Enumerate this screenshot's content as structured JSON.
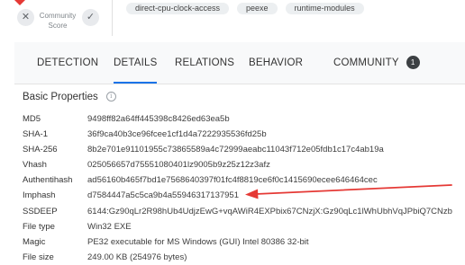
{
  "score": {
    "label": "Community Score",
    "dislike_icon": "close-icon",
    "like_icon": "check-icon"
  },
  "tags": [
    "direct-cpu-clock-access",
    "peexe",
    "runtime-modules"
  ],
  "tabs": [
    {
      "label": "DETECTION",
      "active": false
    },
    {
      "label": "DETAILS",
      "active": true
    },
    {
      "label": "RELATIONS",
      "active": false
    },
    {
      "label": "BEHAVIOR",
      "active": false
    },
    {
      "label": "COMMUNITY",
      "active": false,
      "count": "1"
    }
  ],
  "section": {
    "title": "Basic Properties"
  },
  "properties": [
    {
      "key": "MD5",
      "value": "9498ff82a64ff445398c8426ed63ea5b"
    },
    {
      "key": "SHA-1",
      "value": "36f9ca40b3ce96fcee1cf1d4a7222935536fd25b"
    },
    {
      "key": "SHA-256",
      "value": "8b2e701e91101955c73865589a4c72999aeabc11043f712e05fdb1c17c4ab19a"
    },
    {
      "key": "Vhash",
      "value": "025056657d75551080401lz9005b9z25z12z3afz"
    },
    {
      "key": "Authentihash",
      "value": "ad56160b465f7bd1e7568640397f01fc4f8819ce6f0c1415690ecee646464cec"
    },
    {
      "key": "Imphash",
      "value": "d7584447a5c5ca9b4a55946317137951"
    },
    {
      "key": "SSDEEP",
      "value": "6144:Gz90qLr2R98hUb4UdjzEwG+vqAWiR4EXPbix67CNzjX:Gz90qLc1lWhUbhVqJPbiQ7CNzb"
    },
    {
      "key": "File type",
      "value": "Win32 EXE"
    },
    {
      "key": "Magic",
      "value": "PE32 executable for MS Windows (GUI) Intel 80386 32-bit"
    },
    {
      "key": "File size",
      "value": "249.00 KB (254976 bytes)"
    }
  ],
  "colors": {
    "accent": "#1a73e8",
    "annotation_arrow": "#e53935"
  }
}
